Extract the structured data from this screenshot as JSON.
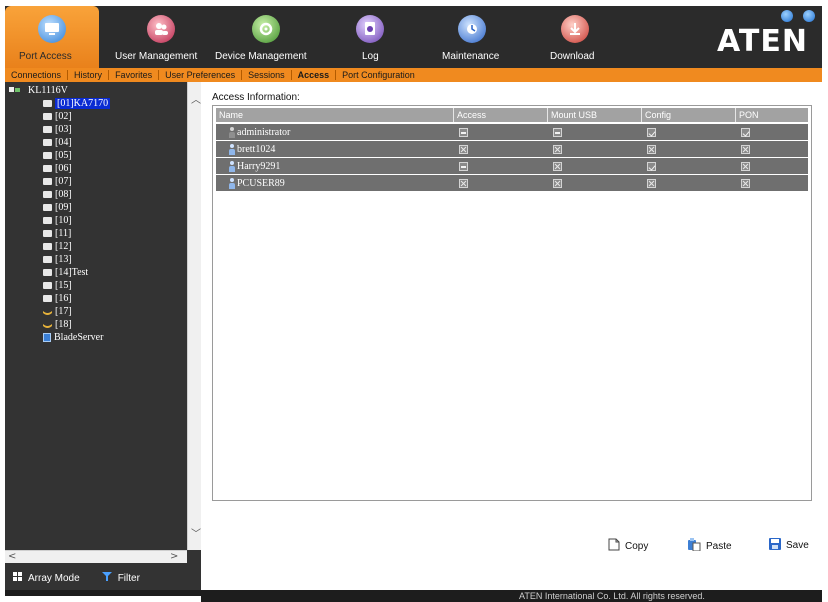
{
  "brand": "ATEN",
  "top_nav": [
    {
      "label": "Port Access",
      "icon": "port-access-icon",
      "color": "#2f7fd6"
    },
    {
      "label": "User Management",
      "icon": "user-management-icon",
      "color": "#b7234a"
    },
    {
      "label": "Device Management",
      "icon": "device-management-icon",
      "color": "#3f8f2a"
    },
    {
      "label": "Log",
      "icon": "log-icon",
      "color": "#6a3fb0"
    },
    {
      "label": "Maintenance",
      "icon": "maintenance-icon",
      "color": "#2a62c6"
    },
    {
      "label": "Download",
      "icon": "download-icon",
      "color": "#c8372f"
    }
  ],
  "sub_tabs": [
    "Connections",
    "History",
    "Favorites",
    "User Preferences",
    "Sessions",
    "Access",
    "Port Configuration"
  ],
  "active_sub_tab": "Access",
  "tree": {
    "root": "KL1116V",
    "items": [
      "[01]KA7170",
      "[02]",
      "[03]",
      "[04]",
      "[05]",
      "[06]",
      "[07]",
      "[08]",
      "[09]",
      "[10]",
      "[11]",
      "[12]",
      "[13]",
      "[14]Test",
      "[15]",
      "[16]",
      "[17]",
      "[18]",
      "BladeServer"
    ],
    "selected": "[01]KA7170"
  },
  "left_footer": {
    "array_mode": "Array Mode",
    "filter": "Filter"
  },
  "access": {
    "title": "Access Information:",
    "columns": [
      "Name",
      "Access",
      "Mount USB",
      "Config",
      "PON"
    ],
    "rows": [
      {
        "name": "administrator",
        "access": "partial",
        "mount_usb": "partial",
        "config": "checked",
        "pon": "checked"
      },
      {
        "name": "brett1024",
        "access": "denied",
        "mount_usb": "denied",
        "config": "denied",
        "pon": "denied"
      },
      {
        "name": "Harry9291",
        "access": "partial",
        "mount_usb": "denied",
        "config": "checked",
        "pon": "denied"
      },
      {
        "name": "PCUSER89",
        "access": "denied",
        "mount_usb": "denied",
        "config": "denied",
        "pon": "denied"
      }
    ]
  },
  "actions": {
    "copy": "Copy",
    "paste": "Paste",
    "save": "Save"
  },
  "status": "ATEN International Co. Ltd. All rights reserved."
}
